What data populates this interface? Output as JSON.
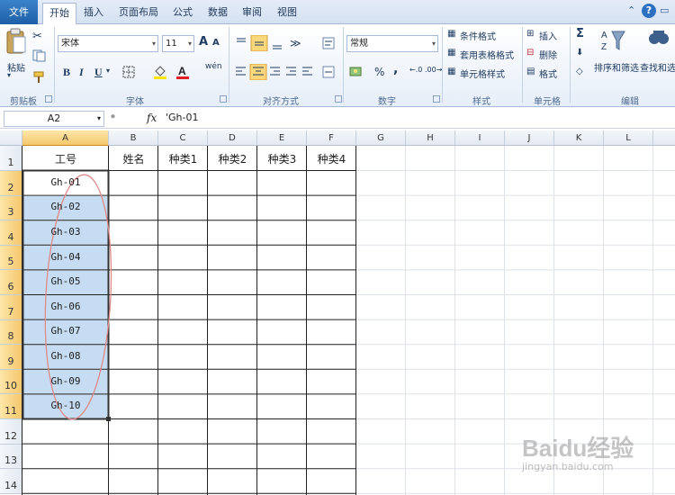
{
  "tabs": {
    "file": "文件",
    "items": [
      "开始",
      "插入",
      "页面布局",
      "公式",
      "数据",
      "审阅",
      "视图"
    ]
  },
  "ribbon": {
    "clipboard": {
      "label": "剪贴板",
      "paste": "粘贴"
    },
    "font": {
      "label": "字体",
      "name": "宋体",
      "size": "11",
      "bold": "B",
      "italic": "I",
      "underline": "U",
      "grow": "A",
      "shrink": "A",
      "wen": "wén"
    },
    "align": {
      "label": "对齐方式"
    },
    "number": {
      "label": "数字",
      "format": "常规",
      "percent": "%",
      "comma": ","
    },
    "styles": {
      "label": "样式",
      "cond": "条件格式",
      "table": "套用表格格式",
      "cell": "单元格样式"
    },
    "cells": {
      "label": "单元格",
      "insert": "插入",
      "delete": "删除",
      "format": "格式"
    },
    "edit": {
      "label": "编辑",
      "sort": "排序和筛选",
      "find": "查找和选择"
    }
  },
  "formula_bar": {
    "name_box": "A2",
    "fx": "fx",
    "content": "'Gh-01"
  },
  "columns": [
    "A",
    "B",
    "C",
    "D",
    "E",
    "F",
    "G",
    "H",
    "I",
    "J",
    "K",
    "L"
  ],
  "rows": [
    "1",
    "2",
    "3",
    "4",
    "5",
    "6",
    "7",
    "8",
    "9",
    "10",
    "11",
    "12",
    "13",
    "14"
  ],
  "headers": [
    "工号",
    "姓名",
    "种类1",
    "种类2",
    "种类3",
    "种类4"
  ],
  "col_a": [
    "Gh-01",
    "Gh-02",
    "Gh-03",
    "Gh-04",
    "Gh-05",
    "Gh-06",
    "Gh-07",
    "Gh-08",
    "Gh-09",
    "Gh-10"
  ],
  "watermark": {
    "brand": "Baidu经验",
    "url": "jingyan.baidu.com"
  },
  "colors": {
    "selection": "#c5dcf3",
    "accent_tab": "#1d5fa8",
    "ellipse": "#e08a8a"
  }
}
